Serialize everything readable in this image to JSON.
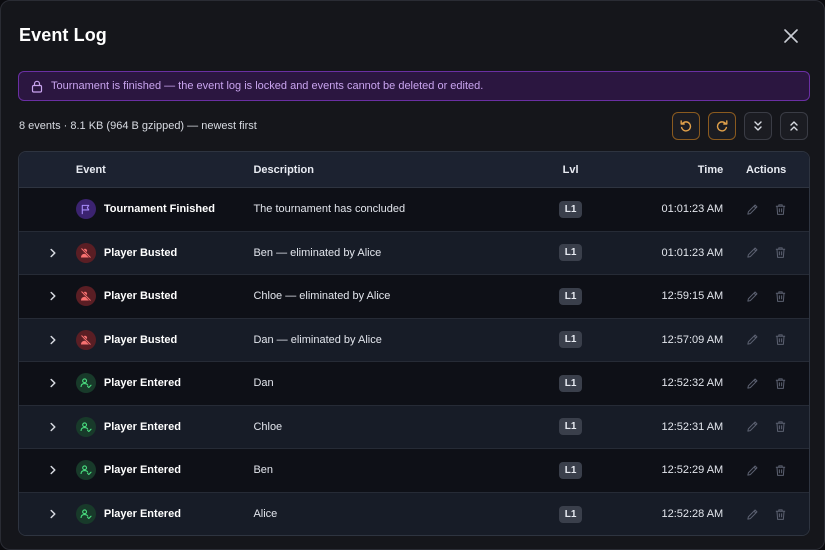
{
  "dialog": {
    "title": "Event Log"
  },
  "banner": {
    "text": "Tournament is finished — the event log is locked and events cannot be deleted or edited."
  },
  "meta": {
    "summary": "8 events · 8.1 KB (964 B gzipped) — newest first"
  },
  "toolbar": {
    "buttons": [
      "undo-icon",
      "redo-icon",
      "expand-all-icon",
      "collapse-all-icon"
    ]
  },
  "table": {
    "headers": {
      "event": "Event",
      "description": "Description",
      "lvl": "Lvl",
      "time": "Time",
      "actions": "Actions"
    },
    "rows": [
      {
        "event": "Tournament Finished",
        "icon": "flag-icon",
        "color": "#a78bfa",
        "description": "The tournament has concluded",
        "lvl": "L1",
        "time": "01:01:23 AM",
        "expandable": false
      },
      {
        "event": "Player Busted",
        "icon": "user-x-icon",
        "color": "#f87171",
        "description": "Ben — eliminated by Alice",
        "lvl": "L1",
        "time": "01:01:23 AM",
        "expandable": true
      },
      {
        "event": "Player Busted",
        "icon": "user-x-icon",
        "color": "#f87171",
        "description": "Chloe — eliminated by Alice",
        "lvl": "L1",
        "time": "12:59:15 AM",
        "expandable": true
      },
      {
        "event": "Player Busted",
        "icon": "user-x-icon",
        "color": "#f87171",
        "description": "Dan — eliminated by Alice",
        "lvl": "L1",
        "time": "12:57:09 AM",
        "expandable": true
      },
      {
        "event": "Player Entered",
        "icon": "user-check-icon",
        "color": "#4ade80",
        "description": "Dan",
        "lvl": "L1",
        "time": "12:52:32 AM",
        "expandable": true
      },
      {
        "event": "Player Entered",
        "icon": "user-check-icon",
        "color": "#4ade80",
        "description": "Chloe",
        "lvl": "L1",
        "time": "12:52:31 AM",
        "expandable": true
      },
      {
        "event": "Player Entered",
        "icon": "user-check-icon",
        "color": "#4ade80",
        "description": "Ben",
        "lvl": "L1",
        "time": "12:52:29 AM",
        "expandable": true
      },
      {
        "event": "Player Entered",
        "icon": "user-check-icon",
        "color": "#4ade80",
        "description": "Alice",
        "lvl": "L1",
        "time": "12:52:28 AM",
        "expandable": true
      }
    ]
  }
}
